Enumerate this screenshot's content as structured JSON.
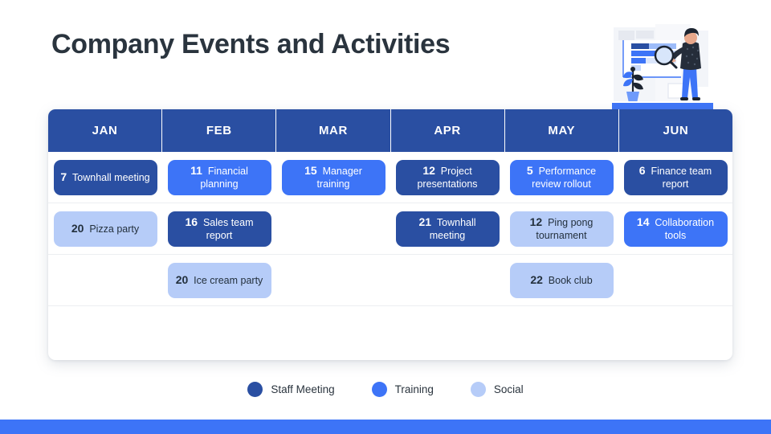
{
  "page_title": "Company Events and Activities",
  "colors": {
    "staff_meeting": "#2a4fa2",
    "training": "#3d74f7",
    "social": "#b6ccf8",
    "title_text": "#2a343e",
    "accent_bar": "#3d74f7"
  },
  "calendar": {
    "months": [
      "JAN",
      "FEB",
      "MAR",
      "APR",
      "MAY",
      "JUN"
    ],
    "rows": [
      [
        {
          "day": "7",
          "label": "Townhall meeting",
          "category": "staff"
        },
        {
          "day": "11",
          "label": "Financial planning",
          "category": "training"
        },
        {
          "day": "15",
          "label": "Manager training",
          "category": "training"
        },
        {
          "day": "12",
          "label": "Project presentations",
          "category": "staff"
        },
        {
          "day": "5",
          "label": "Performance review rollout",
          "category": "training"
        },
        {
          "day": "6",
          "label": "Finance team report",
          "category": "staff"
        }
      ],
      [
        {
          "day": "20",
          "label": "Pizza party",
          "category": "social"
        },
        {
          "day": "16",
          "label": "Sales team report",
          "category": "staff"
        },
        {
          "day": "",
          "label": "",
          "category": "empty"
        },
        {
          "day": "21",
          "label": "Townhall meeting",
          "category": "staff"
        },
        {
          "day": "12",
          "label": "Ping pong tournament",
          "category": "social"
        },
        {
          "day": "14",
          "label": "Collaboration tools",
          "category": "training"
        }
      ],
      [
        {
          "day": "",
          "label": "",
          "category": "empty"
        },
        {
          "day": "20",
          "label": "Ice cream party",
          "category": "social"
        },
        {
          "day": "",
          "label": "",
          "category": "empty"
        },
        {
          "day": "",
          "label": "",
          "category": "empty"
        },
        {
          "day": "22",
          "label": "Book club",
          "category": "social"
        },
        {
          "day": "",
          "label": "",
          "category": "empty"
        }
      ],
      [
        {
          "day": "",
          "label": "",
          "category": "empty"
        },
        {
          "day": "",
          "label": "",
          "category": "empty"
        },
        {
          "day": "",
          "label": "",
          "category": "empty"
        },
        {
          "day": "",
          "label": "",
          "category": "empty"
        },
        {
          "day": "",
          "label": "",
          "category": "empty"
        },
        {
          "day": "",
          "label": "",
          "category": "empty"
        }
      ]
    ]
  },
  "legend": [
    {
      "label": "Staff Meeting",
      "color": "#2a4fa2",
      "category": "staff"
    },
    {
      "label": "Training",
      "color": "#3d74f7",
      "category": "training"
    },
    {
      "label": "Social",
      "color": "#b6ccf8",
      "category": "social"
    }
  ],
  "illustration": {
    "name": "person-analyzing-chart-with-magnifier"
  }
}
